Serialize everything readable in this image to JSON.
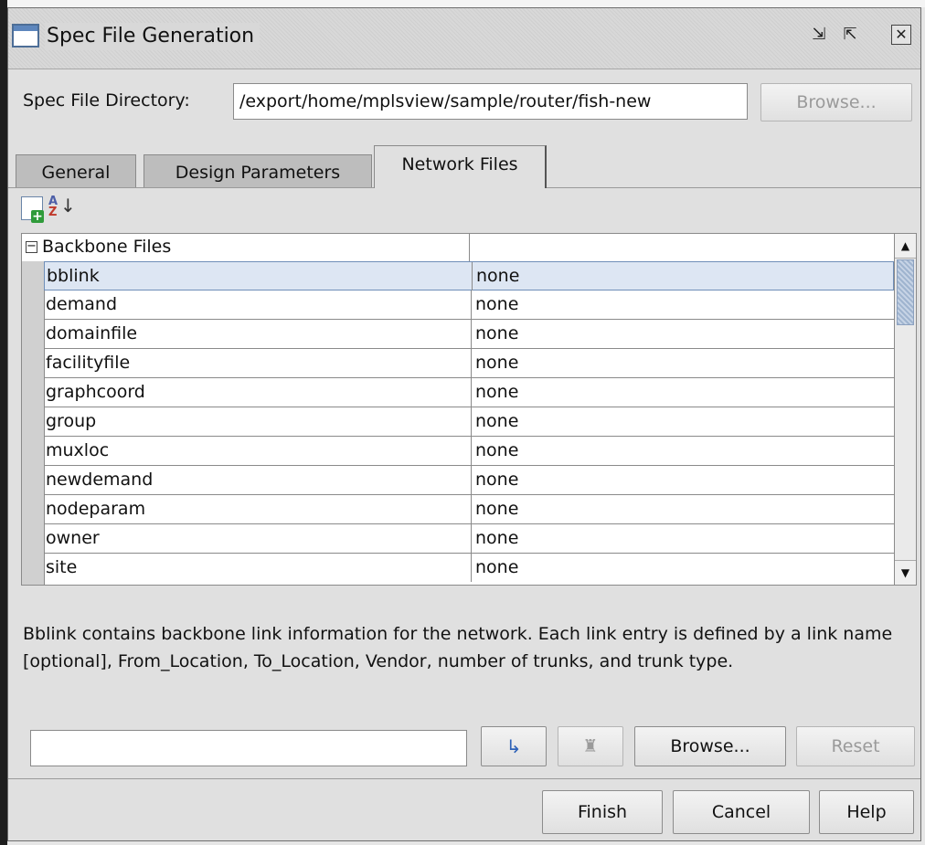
{
  "window": {
    "title": "Spec File Generation",
    "buttons": {
      "minimize": "⇲",
      "maximize": "⇱",
      "close": "✕"
    }
  },
  "directory": {
    "label": "Spec File Directory:",
    "value": "/export/home/mplsview/sample/router/fish-new",
    "browse_label": "Browse..."
  },
  "tabs": [
    {
      "label": "General",
      "active": false
    },
    {
      "label": "Design Parameters",
      "active": false
    },
    {
      "label": "Network Files",
      "active": true
    }
  ],
  "toolbar": {
    "new_icon": "new-file-icon",
    "sort_icon": "sort-az-icon"
  },
  "table": {
    "group": "Backbone Files",
    "rows": [
      {
        "name": "bblink",
        "value": "none",
        "selected": true
      },
      {
        "name": "demand",
        "value": "none"
      },
      {
        "name": "domainfile",
        "value": "none"
      },
      {
        "name": "facilityfile",
        "value": "none"
      },
      {
        "name": "graphcoord",
        "value": "none"
      },
      {
        "name": "group",
        "value": "none"
      },
      {
        "name": "muxloc",
        "value": "none"
      },
      {
        "name": "newdemand",
        "value": "none"
      },
      {
        "name": "nodeparam",
        "value": "none"
      },
      {
        "name": "owner",
        "value": "none"
      },
      {
        "name": "site",
        "value": "none"
      }
    ]
  },
  "description": "Bblink contains backbone link information for the network. Each link entry is defined by a link name [optional], From_Location, To_Location, Vendor, number of trunks, and trunk type.",
  "editor": {
    "value": "",
    "browse_label": "Browse...",
    "reset_label": "Reset"
  },
  "footer": {
    "finish_label": "Finish",
    "cancel_label": "Cancel",
    "help_label": "Help"
  }
}
